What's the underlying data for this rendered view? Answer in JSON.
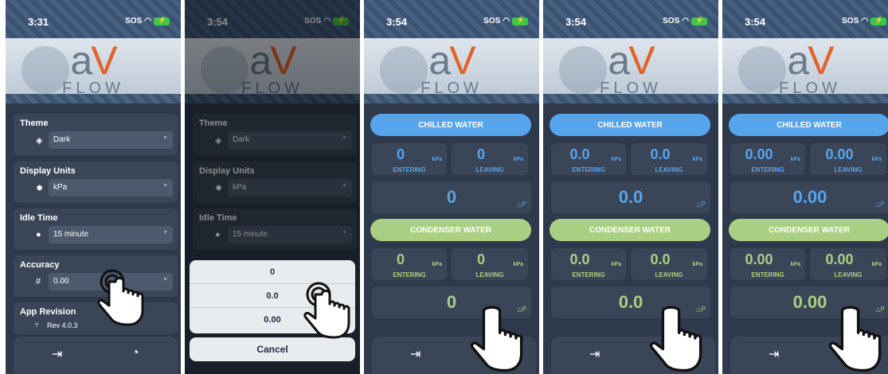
{
  "screens": [
    {
      "time": "3:31",
      "status_text": "SOS",
      "logo": {
        "a": "a",
        "v": "V",
        "flow": "FLOW"
      },
      "settings": [
        {
          "title": "Theme",
          "icon": "paint-bucket-icon",
          "value": "Dark"
        },
        {
          "title": "Display Units",
          "icon": "gear-icon",
          "value": "kPa"
        },
        {
          "title": "Idle Time",
          "icon": "clock-icon",
          "value": "15 minute"
        },
        {
          "title": "Accuracy",
          "icon": "hash-icon",
          "value": "0.00"
        }
      ],
      "revision": {
        "title": "App Revision",
        "value": "Rev 4.0.3"
      }
    },
    {
      "time": "3:54",
      "status_text": "SOS",
      "logo": {
        "a": "a",
        "v": "V",
        "flow": "FLOW"
      },
      "settings": [
        {
          "title": "Theme",
          "icon": "paint-bucket-icon",
          "value": "Dark"
        },
        {
          "title": "Display Units",
          "icon": "gear-icon",
          "value": "kPa"
        },
        {
          "title": "Idle Time",
          "icon": "clock-icon",
          "value": "15 minute"
        }
      ],
      "picker_options": [
        "0",
        "0.0",
        "0.00"
      ],
      "cancel_label": "Cancel"
    },
    {
      "time": "3:54",
      "status_text": "SOS",
      "logo": {
        "a": "a",
        "v": "V",
        "flow": "FLOW"
      },
      "chilled_label": "CHILLED WATER",
      "condenser_label": "CONDENSER WATER",
      "entering": "ENTERING",
      "leaving": "LEAVING",
      "unit": "kPa",
      "dp": "△P",
      "value": "0"
    },
    {
      "time": "3:54",
      "status_text": "SOS",
      "logo": {
        "a": "a",
        "v": "V",
        "flow": "FLOW"
      },
      "chilled_label": "CHILLED WATER",
      "condenser_label": "CONDENSER WATER",
      "entering": "ENTERING",
      "leaving": "LEAVING",
      "unit": "kPa",
      "dp": "△P",
      "value": "0.0"
    },
    {
      "time": "3:54",
      "status_text": "SOS",
      "logo": {
        "a": "a",
        "v": "V",
        "flow": "FLOW"
      },
      "chilled_label": "CHILLED WATER",
      "condenser_label": "CONDENSER WATER",
      "entering": "ENTERING",
      "leaving": "LEAVING",
      "unit": "kPa",
      "dp": "△P",
      "value": "0.00"
    }
  ],
  "colors": {
    "blue": "#56a4ec",
    "green": "#a9cf82",
    "panel": "#2e3a4c"
  }
}
